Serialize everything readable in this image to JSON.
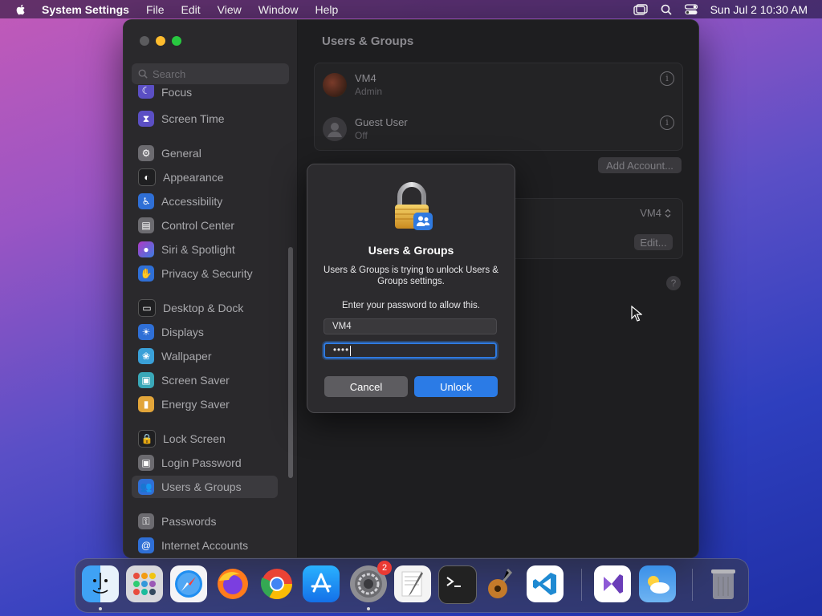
{
  "menubar": {
    "app_name": "System Settings",
    "items": [
      "File",
      "Edit",
      "View",
      "Window",
      "Help"
    ],
    "datetime": "Sun Jul 2  10:30 AM"
  },
  "sidebar": {
    "search_placeholder": "Search",
    "items": [
      {
        "label": "Focus",
        "icon": "moon-icon",
        "color": "#5b4fc4"
      },
      {
        "label": "Screen Time",
        "icon": "hourglass-icon",
        "color": "#5b4fc4"
      },
      {
        "label": "General",
        "icon": "gear-icon",
        "color": "#6c6b70"
      },
      {
        "label": "Appearance",
        "icon": "appearance-icon",
        "color": "#1f1f21"
      },
      {
        "label": "Accessibility",
        "icon": "accessibility-icon",
        "color": "#2f6fd6"
      },
      {
        "label": "Control Center",
        "icon": "control-center-icon",
        "color": "#6c6b70"
      },
      {
        "label": "Siri & Spotlight",
        "icon": "siri-icon",
        "color": "#b03ac6"
      },
      {
        "label": "Privacy & Security",
        "icon": "hand-icon",
        "color": "#2f6fd6"
      },
      {
        "label": "Desktop & Dock",
        "icon": "dock-icon",
        "color": "#1f1f21"
      },
      {
        "label": "Displays",
        "icon": "sun-icon",
        "color": "#2f6fd6"
      },
      {
        "label": "Wallpaper",
        "icon": "wallpaper-icon",
        "color": "#3aa0d8"
      },
      {
        "label": "Screen Saver",
        "icon": "screensaver-icon",
        "color": "#3aa8b8"
      },
      {
        "label": "Energy Saver",
        "icon": "battery-icon",
        "color": "#e2a53a"
      },
      {
        "label": "Lock Screen",
        "icon": "lock-screen-icon",
        "color": "#1f1f21"
      },
      {
        "label": "Login Password",
        "icon": "lock-icon",
        "color": "#6c6b70"
      },
      {
        "label": "Users & Groups",
        "icon": "users-icon",
        "color": "#2f6fd6"
      },
      {
        "label": "Passwords",
        "icon": "key-icon",
        "color": "#6c6b70"
      },
      {
        "label": "Internet Accounts",
        "icon": "at-icon",
        "color": "#2f6fd6"
      }
    ]
  },
  "main": {
    "title": "Users & Groups",
    "users": [
      {
        "name": "VM4",
        "role": "Admin"
      },
      {
        "name": "Guest User",
        "role": "Off"
      }
    ],
    "add_account_label": "Add Account...",
    "auto_login_value": "VM4",
    "edit_label": "Edit...",
    "help_label": "?"
  },
  "dialog": {
    "title": "Users & Groups",
    "message": "Users & Groups is trying to unlock Users & Groups settings.",
    "prompt": "Enter your password to allow this.",
    "username": "VM4",
    "password_mask": "••••",
    "cancel_label": "Cancel",
    "unlock_label": "Unlock"
  },
  "dock": {
    "apps": [
      {
        "name": "Finder",
        "icon": "finder-icon",
        "running": true
      },
      {
        "name": "Launchpad",
        "icon": "launchpad-icon",
        "running": false
      },
      {
        "name": "Safari",
        "icon": "safari-icon",
        "running": false
      },
      {
        "name": "Firefox",
        "icon": "firefox-icon",
        "running": false
      },
      {
        "name": "Chrome",
        "icon": "chrome-icon",
        "running": false
      },
      {
        "name": "App Store",
        "icon": "app-store-icon",
        "running": false
      },
      {
        "name": "System Settings",
        "icon": "system-settings-icon",
        "running": true,
        "badge": "2"
      },
      {
        "name": "TextEdit",
        "icon": "textedit-icon",
        "running": false
      },
      {
        "name": "Terminal",
        "icon": "terminal-icon",
        "running": false
      },
      {
        "name": "GarageBand",
        "icon": "garageband-icon",
        "running": false
      },
      {
        "name": "Visual Studio Code",
        "icon": "vscode-icon",
        "running": false
      },
      {
        "name": "Visual Studio",
        "icon": "visual-studio-icon",
        "running": false
      },
      {
        "name": "Weather",
        "icon": "weather-icon",
        "running": false
      },
      {
        "name": "Trash",
        "icon": "trash-icon",
        "running": false
      }
    ]
  }
}
